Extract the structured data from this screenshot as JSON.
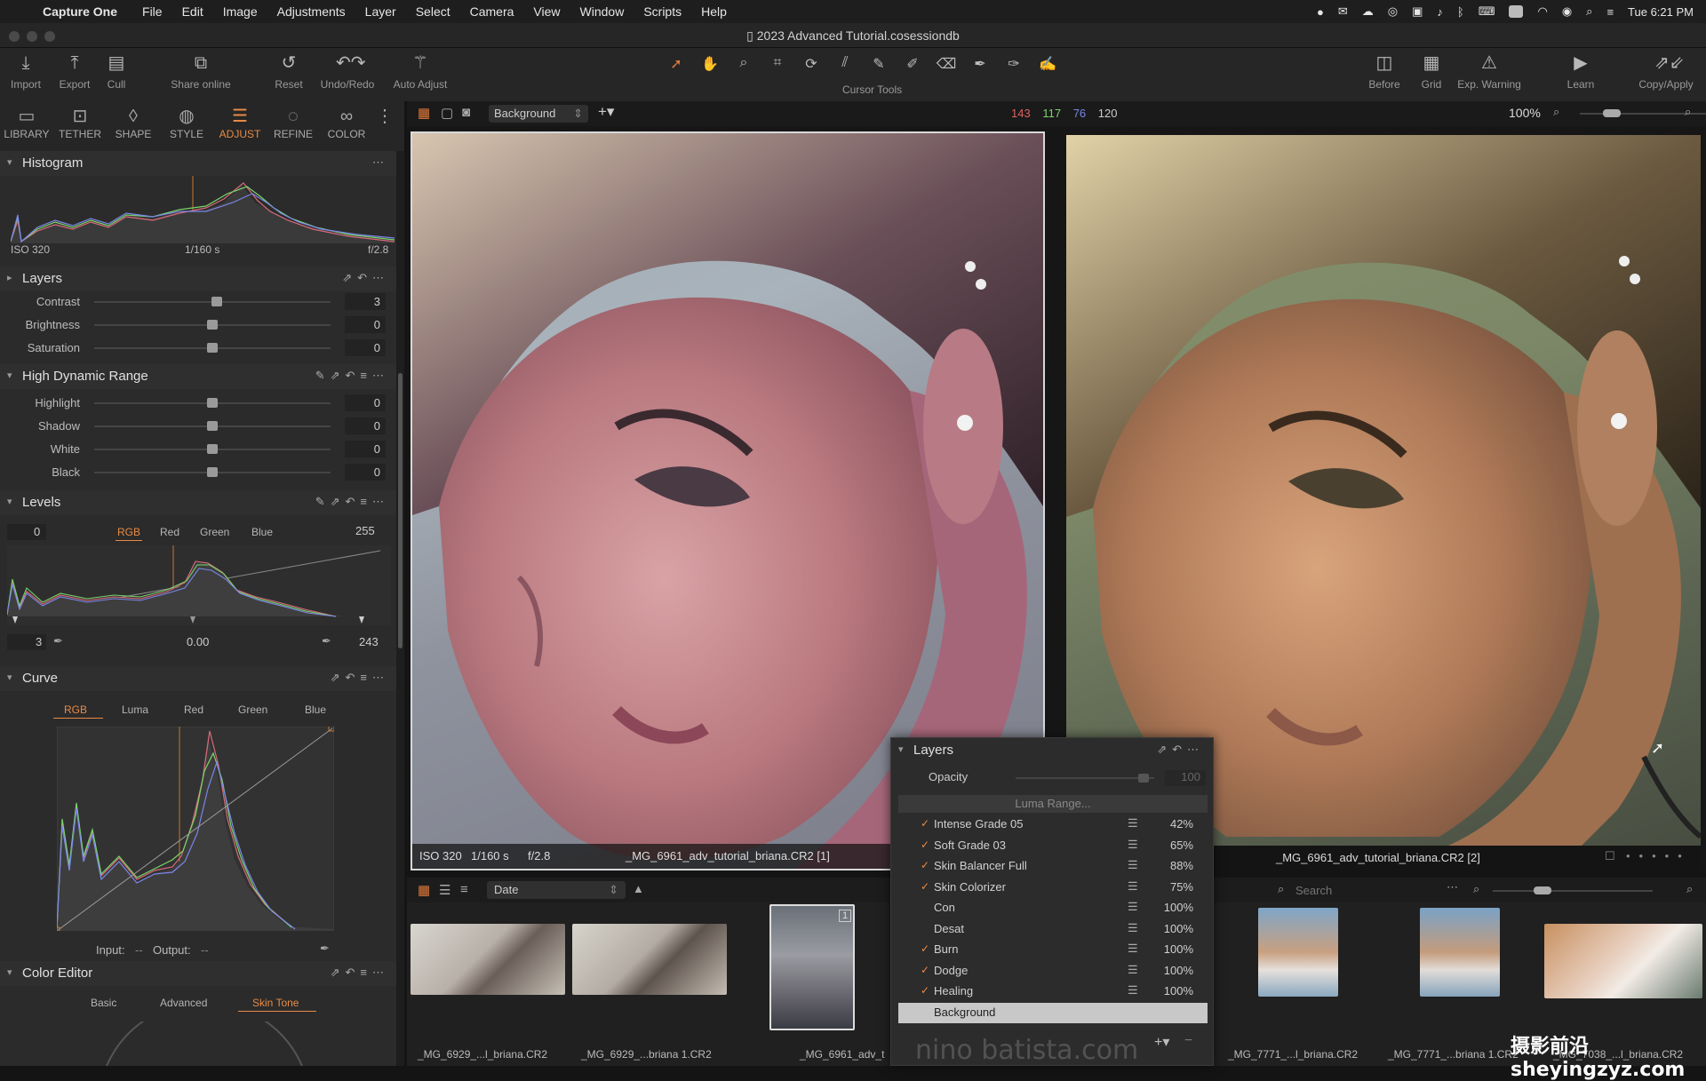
{
  "menubar": {
    "app": "Capture One",
    "items": [
      "File",
      "Edit",
      "Image",
      "Adjustments",
      "Layer",
      "Select",
      "Camera",
      "View",
      "Window",
      "Scripts",
      "Help"
    ],
    "clock": "Tue 6:21 PM"
  },
  "window": {
    "title": "2023 Advanced Tutorial.cosessiondb"
  },
  "toolbar": {
    "import": "Import",
    "export": "Export",
    "cull": "Cull",
    "share": "Share online",
    "reset": "Reset",
    "undoredo": "Undo/Redo",
    "autoadjust": "Auto Adjust",
    "cursortools": "Cursor Tools",
    "before": "Before",
    "grid": "Grid",
    "expwarning": "Exp. Warning",
    "learn": "Learn",
    "copyapply": "Copy/Apply"
  },
  "tooltabs": [
    "LIBRARY",
    "TETHER",
    "SHAPE",
    "STYLE",
    "ADJUST",
    "REFINE",
    "COLOR"
  ],
  "histogram": {
    "title": "Histogram",
    "iso": "ISO 320",
    "shutter": "1/160 s",
    "aperture": "f/2.8"
  },
  "layers_tool": {
    "title": "Layers",
    "sliders": [
      {
        "label": "Contrast",
        "value": "3",
        "pos": 0.52
      },
      {
        "label": "Brightness",
        "value": "0",
        "pos": 0.5
      },
      {
        "label": "Saturation",
        "value": "0",
        "pos": 0.5
      }
    ]
  },
  "hdr": {
    "title": "High Dynamic Range",
    "sliders": [
      {
        "label": "Highlight",
        "value": "0",
        "pos": 0.5
      },
      {
        "label": "Shadow",
        "value": "0",
        "pos": 0.5
      },
      {
        "label": "White",
        "value": "0",
        "pos": 0.5
      },
      {
        "label": "Black",
        "value": "0",
        "pos": 0.5
      }
    ]
  },
  "levels": {
    "title": "Levels",
    "in_low": "0",
    "in_high": "255",
    "channels": [
      "RGB",
      "Red",
      "Green",
      "Blue"
    ],
    "out_low": "3",
    "mid": "0.00",
    "out_high": "243"
  },
  "curve": {
    "title": "Curve",
    "channels": [
      "RGB",
      "Luma",
      "Red",
      "Green",
      "Blue"
    ],
    "input_label": "Input:",
    "input_val": "--",
    "output_label": "Output:",
    "output_val": "--"
  },
  "color_editor": {
    "title": "Color Editor",
    "tabs": [
      "Basic",
      "Advanced",
      "Skin Tone"
    ]
  },
  "viewbar": {
    "layer": "Background",
    "r": "143",
    "g": "117",
    "b": "76",
    "l": "120",
    "zoom": "100%"
  },
  "viewer": {
    "left": {
      "iso": "ISO 320",
      "shutter": "1/160 s",
      "aperture": "f/2.8",
      "name": "_MG_6961_adv_tutorial_briana.CR2 [1]"
    },
    "right": {
      "name": "_MG_6961_adv_tutorial_briana.CR2 [2]"
    }
  },
  "browser": {
    "sort": "Date",
    "search_placeholder": "Search"
  },
  "filmstrip": [
    {
      "name": "_MG_6929_...l_briana.CR2"
    },
    {
      "name": "_MG_6929_...briana 1.CR2"
    },
    {
      "name": "_MG_6961_adv_t"
    },
    {
      "name": "_MG_7771_...l_briana.CR2"
    },
    {
      "name": "_MG_7771_...briana 1.CR2"
    },
    {
      "name": "_MG_7038_...l_briana.CR2"
    }
  ],
  "layers_popup": {
    "title": "Layers",
    "opacity_label": "Opacity",
    "opacity_value": "100",
    "luma_range": "Luma Range...",
    "layers": [
      {
        "name": "Intense Grade 05",
        "pct": "42%",
        "checked": true
      },
      {
        "name": "Soft Grade 03",
        "pct": "65%",
        "checked": true
      },
      {
        "name": "Skin Balancer Full",
        "pct": "88%",
        "checked": true
      },
      {
        "name": "Skin Colorizer",
        "pct": "75%",
        "checked": true
      },
      {
        "name": "Con",
        "pct": "100%",
        "checked": false
      },
      {
        "name": "Desat",
        "pct": "100%",
        "checked": false
      },
      {
        "name": "Burn",
        "pct": "100%",
        "checked": true
      },
      {
        "name": "Dodge",
        "pct": "100%",
        "checked": true
      },
      {
        "name": "Healing",
        "pct": "100%",
        "checked": true
      },
      {
        "name": "Background",
        "pct": "",
        "checked": false
      }
    ]
  },
  "watermark": {
    "text": "摄影前沿 sheyingzyz.com",
    "faint": "nino batista.com"
  }
}
